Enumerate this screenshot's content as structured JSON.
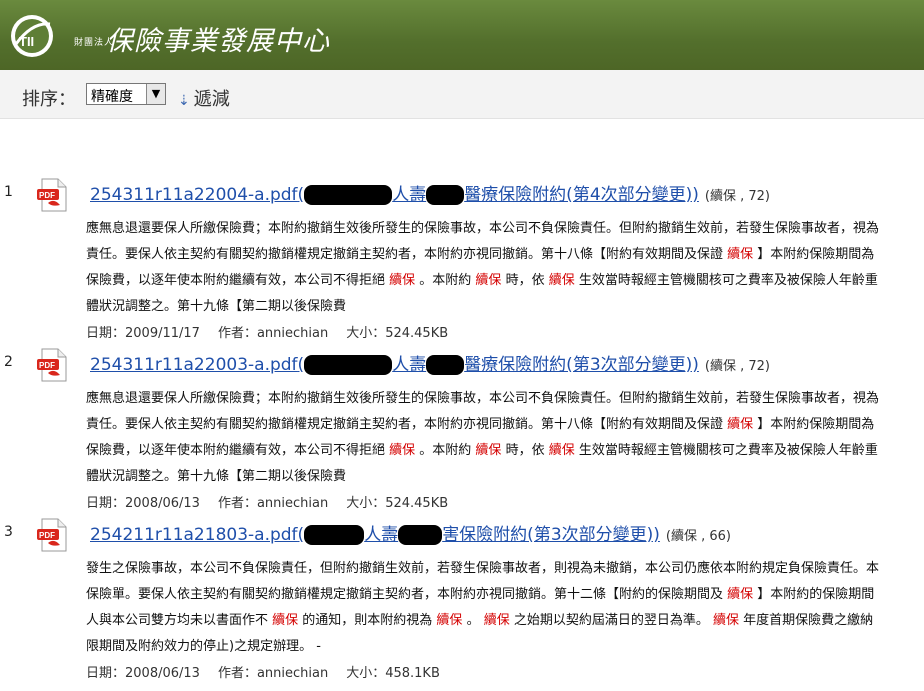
{
  "header": {
    "logo_letters": "TII",
    "org_prefix": "財團法人",
    "org_name": "保險事業發展中心"
  },
  "toolbar": {
    "sort_label": "排序：",
    "sort_value": "精確度",
    "order_label": "遞減",
    "order_arrow": "⇣"
  },
  "results": [
    {
      "index": "1",
      "file": "254311r11a22004-a.pdf",
      "title_visible_1": "人壽",
      "title_visible_2": "醫療保險附約(第4次部分變更))",
      "meta": "(續保 , 72)",
      "lines": [
        [
          "應無息退還要保人所繳保險費；本附約撤銷生效後所發生的保險事故，本公司不負保險責任。但附約撤銷生效前，若發生保險事故者，視為"
        ],
        [
          "責任。要保人依主契約有關契約撤銷權規定撤銷主契約者，本附約亦視同撤銷。第十八條【附約有效期間及保證 ",
          "續保",
          " 】本附約保險期間為"
        ],
        [
          "保險費，以逐年使本附約繼續有效，本公司不得拒絕 ",
          "續保",
          " 。本附約 ",
          "續保",
          " 時，依 ",
          "續保",
          " 生效當時報經主管機關核可之費率及被保險人年齡重"
        ],
        [
          "體狀況調整之。第十九條【第二期以後保險費"
        ]
      ],
      "date": "日期：2009/11/17",
      "author": "作者：anniechian",
      "size": "大小：524.45KB"
    },
    {
      "index": "2",
      "file": "254311r11a22003-a.pdf",
      "title_visible_1": "人壽",
      "title_visible_2": "醫療保險附約(第3次部分變更))",
      "meta": "(續保 , 72)",
      "lines": [
        [
          "應無息退還要保人所繳保險費；本附約撤銷生效後所發生的保險事故，本公司不負保險責任。但附約撤銷生效前，若發生保險事故者，視為"
        ],
        [
          "責任。要保人依主契約有關契約撤銷權規定撤銷主契約者，本附約亦視同撤銷。第十八條【附約有效期間及保證 ",
          "續保",
          " 】本附約保險期間為"
        ],
        [
          "保險費，以逐年使本附約繼續有效，本公司不得拒絕 ",
          "續保",
          " 。本附約 ",
          "續保",
          " 時，依 ",
          "續保",
          " 生效當時報經主管機關核可之費率及被保險人年齡重"
        ],
        [
          "體狀況調整之。第十九條【第二期以後保險費"
        ]
      ],
      "date": "日期：2008/06/13",
      "author": "作者：anniechian",
      "size": "大小：524.45KB"
    },
    {
      "index": "3",
      "file": "254211r11a21803-a.pdf",
      "title_visible_1": "人壽",
      "title_visible_2": "害保險附約(第3次部分變更))",
      "meta": "(續保 , 66)",
      "lines": [
        [
          "發生之保險事故，本公司不負保險責任，但附約撤銷生效前，若發生保險事故者，則視為未撤銷，本公司仍應依本附約規定負保險責任。本"
        ],
        [
          "保險單。要保人依主契約有關契約撤銷權規定撤銷主契約者，本附約亦視同撤銷。第十二條【附約的保險期間及 ",
          "續保",
          " 】本附約的保險期間"
        ],
        [
          "人與本公司雙方均未以書面作不 ",
          "續保",
          " 的通知，則本附約視為 ",
          "續保",
          " 。 ",
          "續保",
          " 之始期以契約屆滿日的翌日為準。 ",
          "續保",
          " 年度首期保險費之繳納"
        ],
        [
          "限期間及附約效力的停止)之規定辦理。 -"
        ]
      ],
      "date": "日期：2008/06/13",
      "author": "作者：anniechian",
      "size": "大小：458.1KB"
    }
  ]
}
